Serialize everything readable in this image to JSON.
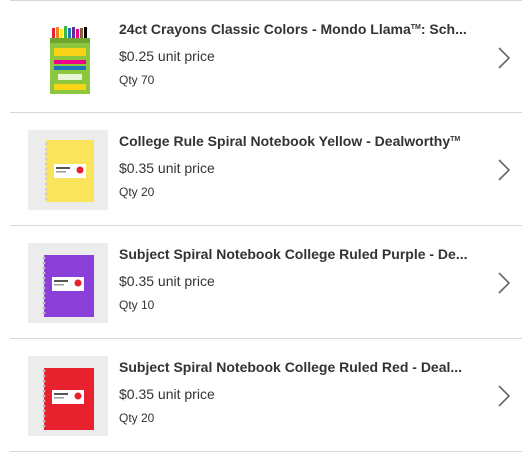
{
  "items": [
    {
      "title": "24ct Crayons Classic Colors - Mondo Llama",
      "title_suffix": "TM",
      "title_tail": ": Sch...",
      "price": "$0.25 unit price",
      "qty": "Qty 70",
      "image": "crayons-box-image",
      "colors": {
        "main": "#8dc63f",
        "accent": "#f7d417"
      }
    },
    {
      "title": "College Rule Spiral Notebook Yellow - Dealworthy",
      "title_suffix": "TM",
      "title_tail": "",
      "price": "$0.35 unit price",
      "qty": "Qty 20",
      "image": "yellow-notebook-image",
      "colors": {
        "main": "#f9e45b"
      }
    },
    {
      "title": "Subject Spiral Notebook College Ruled Purple - De...",
      "title_suffix": "",
      "title_tail": "",
      "price": "$0.35 unit price",
      "qty": "Qty 10",
      "image": "purple-notebook-image",
      "colors": {
        "main": "#8a3fd9"
      }
    },
    {
      "title": "Subject Spiral Notebook College Ruled Red - Deal...",
      "title_suffix": "",
      "title_tail": "",
      "price": "$0.35 unit price",
      "qty": "Qty 20",
      "image": "red-notebook-image",
      "colors": {
        "main": "#e8212e"
      }
    }
  ],
  "chevron_icon": "chevron-right-icon"
}
